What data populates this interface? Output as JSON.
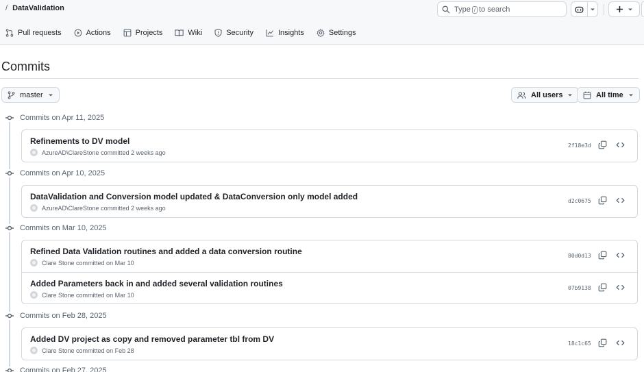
{
  "header": {
    "breadcrumb_separator": "/",
    "repo_name": "DataValidation",
    "search": {
      "prefix": "Type",
      "key": "/",
      "suffix": "to search"
    },
    "icons": [
      "search-icon",
      "copilot-icon",
      "chevron-down-icon",
      "plus-icon"
    ]
  },
  "nav": {
    "tabs": [
      {
        "label": "Pull requests",
        "icon": "git-pull-request-icon"
      },
      {
        "label": "Actions",
        "icon": "play-icon"
      },
      {
        "label": "Projects",
        "icon": "table-icon"
      },
      {
        "label": "Wiki",
        "icon": "book-icon"
      },
      {
        "label": "Security",
        "icon": "shield-icon"
      },
      {
        "label": "Insights",
        "icon": "graph-icon"
      },
      {
        "label": "Settings",
        "icon": "gear-icon"
      }
    ]
  },
  "page": {
    "title": "Commits"
  },
  "filters": {
    "branch": "master",
    "users": "All users",
    "time": "All time"
  },
  "groups": [
    {
      "date_label": "Commits on Apr 11, 2025",
      "commits": [
        {
          "message": "Refinements to DV model",
          "author": "AzureAD\\ClareStone",
          "action": "committed",
          "when": "2 weeks ago",
          "sha": "2f18e3d"
        }
      ]
    },
    {
      "date_label": "Commits on Apr 10, 2025",
      "commits": [
        {
          "message": "DataValidation and Conversion model updated & DataConversion only model added",
          "author": "AzureAD\\ClareStone",
          "action": "committed",
          "when": "2 weeks ago",
          "sha": "d2c0675"
        }
      ]
    },
    {
      "date_label": "Commits on Mar 10, 2025",
      "commits": [
        {
          "message": "Refined Data Validation routines and added a data conversion routine",
          "author": "Clare Stone",
          "action": "committed on",
          "when": "Mar 10",
          "sha": "80d0d13"
        },
        {
          "message": "Added Parameters back in and added several validation routines",
          "author": "Clare Stone",
          "action": "committed on",
          "when": "Mar 10",
          "sha": "07b9138"
        }
      ]
    },
    {
      "date_label": "Commits on Feb 28, 2025",
      "commits": [
        {
          "message": "Added DV project as copy and removed parameter tbl from DV",
          "author": "Clare Stone",
          "action": "committed on",
          "when": "Feb 28",
          "sha": "18c1c65"
        }
      ]
    },
    {
      "date_label": "Commits on Feb 27, 2025",
      "commits": []
    }
  ]
}
